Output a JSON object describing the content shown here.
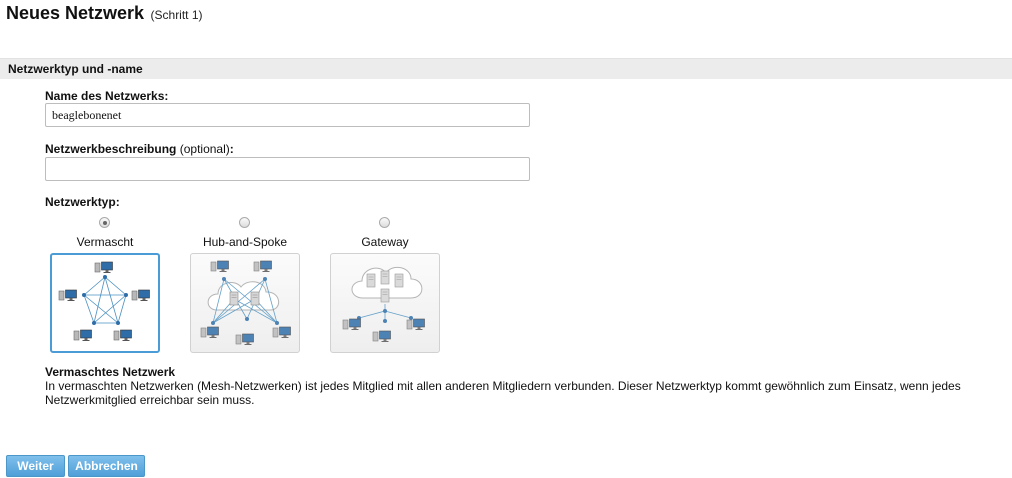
{
  "header": {
    "title": "Neues Netzwerk",
    "step": "(Schritt 1)"
  },
  "section": {
    "title": "Netzwerktyp und -name"
  },
  "form": {
    "name_label": "Name des Netzwerks:",
    "name_value": "beaglebonenet",
    "description_label": "Netzwerkbeschreibung",
    "description_optional": "(optional)",
    "description_colon": ":",
    "description_value": "",
    "type_label": "Netzwerktyp:"
  },
  "network_types": [
    {
      "label": "Vermascht",
      "selected": true,
      "icon": "mesh-network-icon"
    },
    {
      "label": "Hub-and-Spoke",
      "selected": false,
      "icon": "hub-spoke-network-icon"
    },
    {
      "label": "Gateway",
      "selected": false,
      "icon": "gateway-network-icon"
    }
  ],
  "description": {
    "title": "Vermaschtes Netzwerk",
    "text": "In vermaschten Netzwerken (Mesh-Netzwerken) ist jedes Mitglied mit allen anderen Mitgliedern verbunden. Dieser Netzwerktyp kommt gewöhnlich zum Einsatz, wenn jedes Netzwerkmitglied erreichbar sein muss."
  },
  "buttons": {
    "next": "Weiter",
    "cancel": "Abbrechen"
  },
  "colors": {
    "accent": "#4a9bd6",
    "button": "#5ba7dc",
    "section_bg": "#ececec",
    "line": "#4a90c0"
  }
}
